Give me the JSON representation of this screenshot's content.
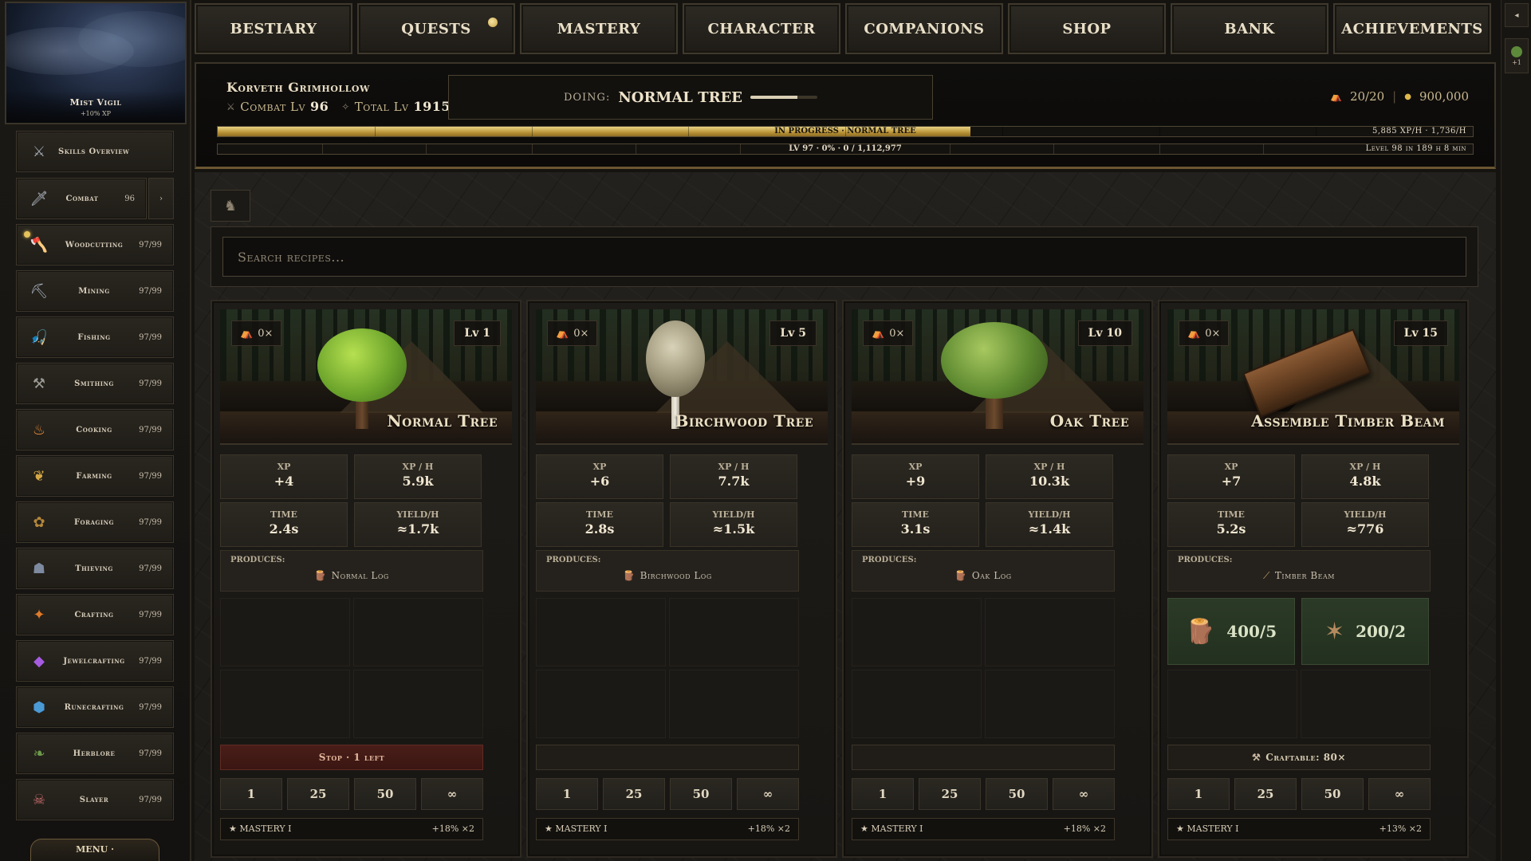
{
  "zone": {
    "name": "Mist Vigil",
    "bonus": "+10% XP"
  },
  "sidebar": {
    "items": [
      {
        "label": "Skills Overview",
        "level": "",
        "icon": "crossed-swords-icon"
      },
      {
        "label": "Combat",
        "level": "96",
        "icon": "sword-icon"
      },
      {
        "label": "Woodcutting",
        "level": "97/99",
        "icon": "axe-icon"
      },
      {
        "label": "Mining",
        "level": "97/99",
        "icon": "pickaxe-icon"
      },
      {
        "label": "Fishing",
        "level": "97/99",
        "icon": "fishing-rod-icon"
      },
      {
        "label": "Smithing",
        "level": "97/99",
        "icon": "anvil-icon"
      },
      {
        "label": "Cooking",
        "level": "97/99",
        "icon": "cooking-pot-icon"
      },
      {
        "label": "Farming",
        "level": "97/99",
        "icon": "wheat-icon"
      },
      {
        "label": "Foraging",
        "level": "97/99",
        "icon": "herb-icon"
      },
      {
        "label": "Thieving",
        "level": "97/99",
        "icon": "mask-icon"
      },
      {
        "label": "Crafting",
        "level": "97/99",
        "icon": "hammer-icon"
      },
      {
        "label": "Jewelcrafting",
        "level": "97/99",
        "icon": "gem-icon"
      },
      {
        "label": "Runecrafting",
        "level": "97/99",
        "icon": "rune-icon"
      },
      {
        "label": "Herblore",
        "level": "97/99",
        "icon": "leaf-icon"
      },
      {
        "label": "Slayer",
        "level": "97/99",
        "icon": "skull-icon"
      }
    ],
    "combat_expand": "›",
    "menu_label": "MENU ·"
  },
  "nav": {
    "tabs": [
      "BESTIARY",
      "QUESTS",
      "MASTERY",
      "CHARACTER",
      "COMPANIONS",
      "SHOP",
      "BANK",
      "ACHIEVEMENTS"
    ]
  },
  "status": {
    "char_name": "Korveth Grimhollow",
    "combat_label": "Combat Lv",
    "combat_lv": "96",
    "total_label": "Total Lv",
    "total_lv": "1915",
    "doing_label": "DOING:",
    "doing_value": "NORMAL TREE",
    "doing_progress": 0.7,
    "inventory": "20/20",
    "gold": "900,000",
    "bar1_label": "IN PROGRESS · NORMAL TREE",
    "bar1_right": "5,885 XP/H · 1,736/H",
    "bar1_progress": 0.6,
    "bar2_label": "LV 97 · 0% · 0 / 1,112,977",
    "bar2_right": "Level 98 in 189 h 8 min",
    "bar2_progress": 0
  },
  "main": {
    "filter_icon": "filter-icon",
    "search_placeholder": "Search recipes..."
  },
  "cards": [
    {
      "count": "0×",
      "level": "Lv 1",
      "title": "Normal Tree",
      "xp": "+4",
      "xph": "5.9k",
      "time": "2.4s",
      "yield": "≈1.7k",
      "produces": "Normal Log",
      "action": "Stop · 1 left",
      "mastery_left": "★ MASTERY I",
      "mastery_right": "+18% ×2"
    },
    {
      "count": "0×",
      "level": "Lv 5",
      "title": "Birchwood Tree",
      "xp": "+6",
      "xph": "7.7k",
      "time": "2.8s",
      "yield": "≈1.5k",
      "produces": "Birchwood Log",
      "action": "",
      "mastery_left": "★ MASTERY I",
      "mastery_right": "+18% ×2"
    },
    {
      "count": "0×",
      "level": "Lv 10",
      "title": "Oak Tree",
      "xp": "+9",
      "xph": "10.3k",
      "time": "3.1s",
      "yield": "≈1.4k",
      "produces": "Oak Log",
      "action": "",
      "mastery_left": "★ MASTERY I",
      "mastery_right": "+18% ×2"
    },
    {
      "count": "0×",
      "level": "Lv 15",
      "title": "Assemble Timber Beam",
      "xp": "+7",
      "xph": "4.8k",
      "time": "5.2s",
      "yield": "≈776",
      "produces": "Timber Beam",
      "action": "Craftable: 80×",
      "req1": "400/5",
      "req2": "200/2",
      "mastery_left": "★ MASTERY I",
      "mastery_right": "+13% ×2"
    }
  ],
  "stat_labels": {
    "xp": "XP",
    "xph": "XP / H",
    "time": "TIME",
    "yield": "YIELD/H",
    "produces": "PRODUCES:"
  },
  "qty_options": [
    "1",
    "25",
    "50",
    "∞"
  ],
  "colors": {
    "accent_gold": "#e0c36a",
    "stop_red": "#4a1e18",
    "req_green": "#2b3a26"
  }
}
